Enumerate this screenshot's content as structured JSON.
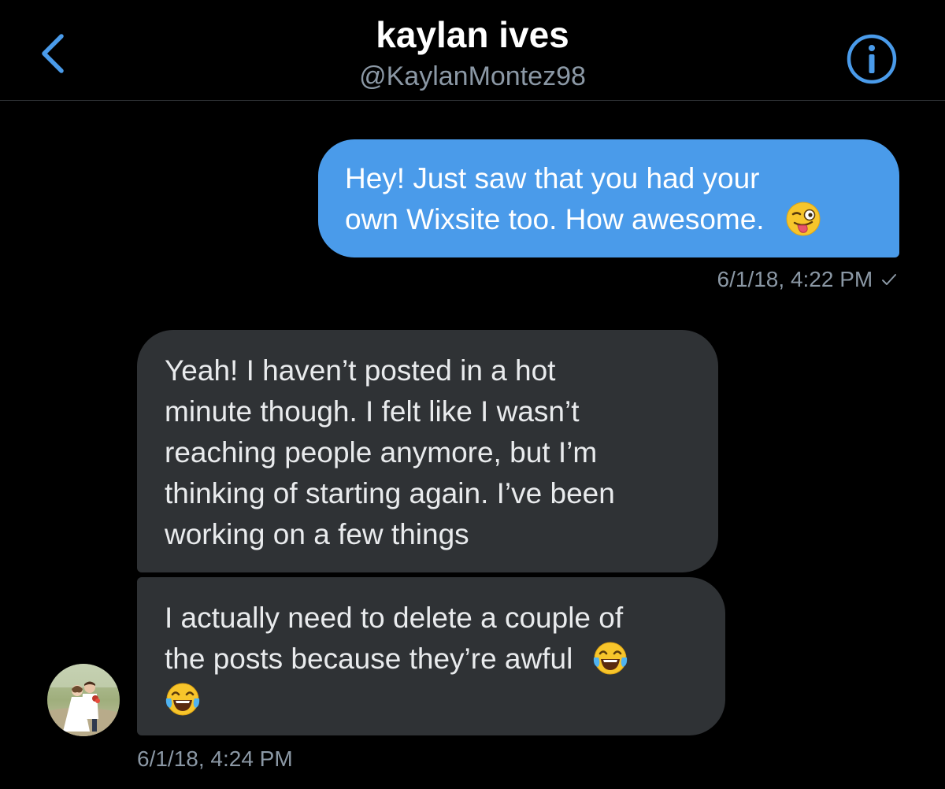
{
  "header": {
    "title": "kaylan ives",
    "handle": "@KaylanMontez98",
    "back_icon": "chevron-left-icon",
    "info_icon": "info-icon",
    "accent_color": "#4a9bea"
  },
  "messages": [
    {
      "direction": "outgoing",
      "lines": [
        "Hey! Just saw that you had your",
        "own Wixsite too. How awesome."
      ],
      "trailing_emoji": "winking-face-with-tongue-icon",
      "timestamp": "6/1/18, 4:22 PM",
      "status_icon": "checkmark-icon",
      "bubble_color": "#4a9bea"
    },
    {
      "direction": "incoming",
      "lines": [
        "Yeah! I haven’t posted in a hot",
        "minute though. I felt like I wasn’t",
        "reaching people anymore, but I’m",
        "thinking of starting again. I’ve been",
        "working on a few things"
      ],
      "bubble_color": "#2f3235"
    },
    {
      "direction": "incoming",
      "lines": [
        "I actually need to delete a couple of",
        "the posts because they’re awful"
      ],
      "trailing_emoji": "face-with-tears-of-joy-icon",
      "extra_emoji": "face-with-tears-of-joy-icon",
      "timestamp": "6/1/18, 4:24 PM",
      "bubble_color": "#2f3235"
    }
  ],
  "sender": {
    "avatar_icon": "wedding-photo-avatar"
  }
}
